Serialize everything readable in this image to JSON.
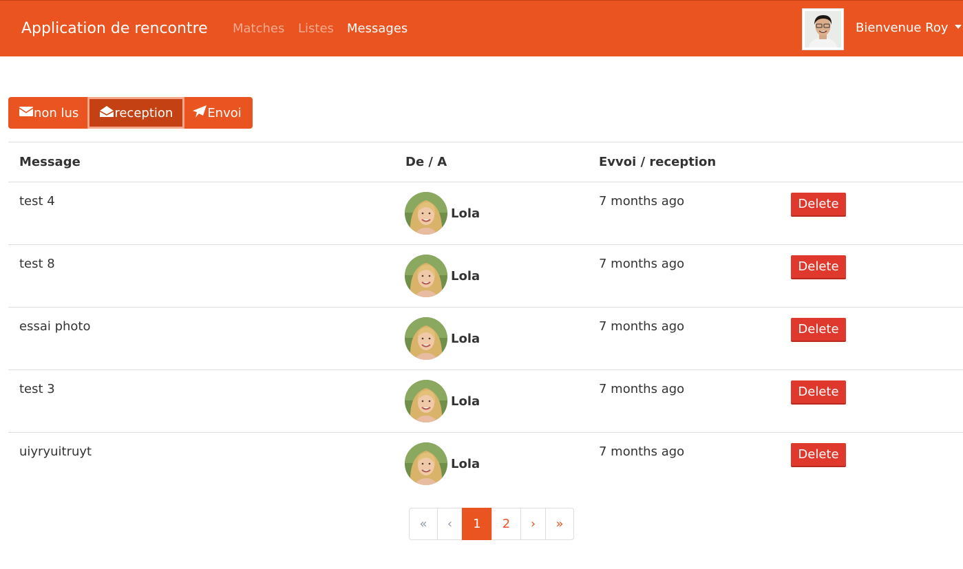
{
  "navbar": {
    "brand": "Application de rencontre",
    "links": [
      {
        "label": "Matches",
        "active": false
      },
      {
        "label": "Listes",
        "active": false
      },
      {
        "label": "Messages",
        "active": true
      }
    ],
    "user_menu": "Bienvenue Roy"
  },
  "filters": {
    "unread": "non lus",
    "inbox": "reception",
    "sent": "Envoi"
  },
  "table": {
    "headers": {
      "message": "Message",
      "from_to": "De / A",
      "date": "Evvoi / reception"
    },
    "rows": [
      {
        "message": "test 4",
        "from": "Lola",
        "date": "7 months ago",
        "action": "Delete"
      },
      {
        "message": "test 8",
        "from": "Lola",
        "date": "7 months ago",
        "action": "Delete"
      },
      {
        "message": "essai photo",
        "from": "Lola",
        "date": "7 months ago",
        "action": "Delete"
      },
      {
        "message": "test 3",
        "from": "Lola",
        "date": "7 months ago",
        "action": "Delete"
      },
      {
        "message": "uiyryuitruyt",
        "from": "Lola",
        "date": "7 months ago",
        "action": "Delete"
      }
    ]
  },
  "pagination": {
    "first": "«",
    "prev": "‹",
    "pages": [
      "1",
      "2"
    ],
    "current": "1",
    "next": "›",
    "last": "»"
  },
  "colors": {
    "primary": "#e95420",
    "active": "#c34113",
    "danger": "#df382c"
  }
}
